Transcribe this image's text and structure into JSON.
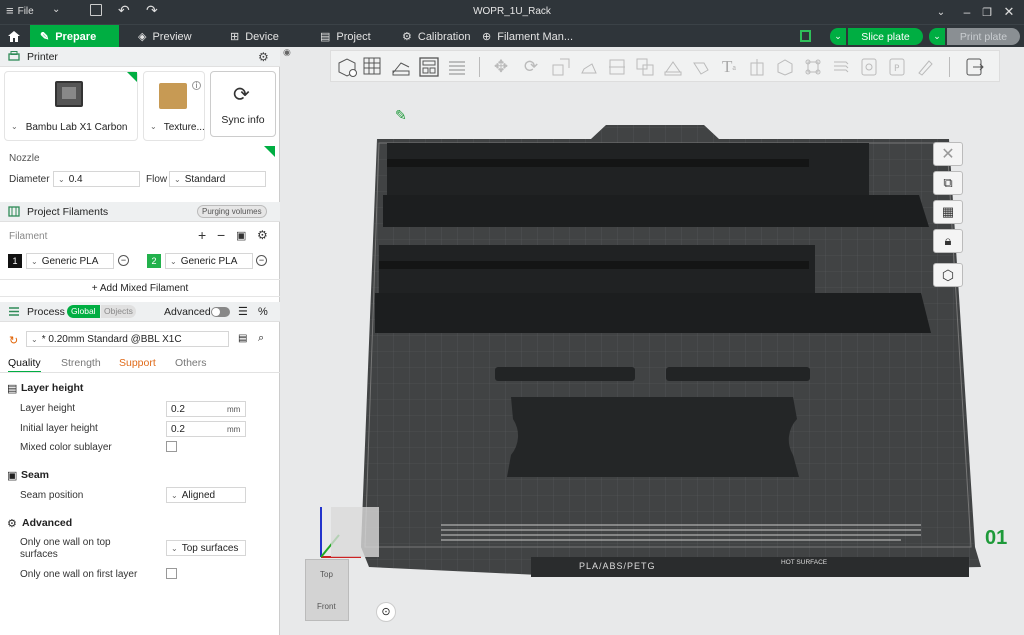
{
  "titlebar": {
    "menu_label": "File",
    "title": "WOPR_1U_Rack"
  },
  "tabs": [
    {
      "label": "Prepare"
    },
    {
      "label": "Preview"
    },
    {
      "label": "Device"
    },
    {
      "label": "Project"
    },
    {
      "label": "Calibration"
    },
    {
      "label": "Filament Man..."
    }
  ],
  "actions": {
    "slice_label": "Slice plate",
    "print_label": "Print plate"
  },
  "printer": {
    "section_title": "Printer",
    "printer_name": "Bambu Lab X1 Carbon",
    "plate_name": "Texture...",
    "sync_label": "Sync info",
    "nozzle_label": "Nozzle",
    "diameter_label": "Diameter",
    "diameter_value": "0.4",
    "flow_label": "Flow",
    "flow_value": "Standard"
  },
  "filaments": {
    "section_title": "Project Filaments",
    "purging_label": "Purging volumes",
    "filament_label": "Filament",
    "items": [
      {
        "index": "1",
        "name": "Generic PLA",
        "color": "#111111"
      },
      {
        "index": "2",
        "name": "Generic PLA",
        "color": "#22b14c"
      }
    ],
    "add_mixed_label": "+ Add Mixed Filament"
  },
  "process": {
    "section_title": "Process",
    "global_label": "Global",
    "objects_label": "Objects",
    "advanced_label": "Advanced",
    "preset": "* 0.20mm Standard @BBL X1C",
    "tabs": [
      "Quality",
      "Strength",
      "Support",
      "Others"
    ],
    "layer_height": {
      "title": "Layer height",
      "rows": [
        {
          "label": "Layer height",
          "value": "0.2",
          "unit": "mm"
        },
        {
          "label": "Initial layer height",
          "value": "0.2",
          "unit": "mm"
        }
      ],
      "mixed_label": "Mixed color sublayer"
    },
    "seam": {
      "title": "Seam",
      "position_label": "Seam position",
      "position_value": "Aligned"
    },
    "advanced": {
      "title": "Advanced",
      "one_wall_top_label": "Only one wall on top surfaces",
      "one_wall_top_value": "Top surfaces",
      "one_wall_first_label": "Only one wall on first layer"
    }
  },
  "viewport": {
    "plate_number": "01",
    "plate_label": "PLA/ABS/PETG",
    "hot_surface_label": "HOT SURFACE",
    "cube_top": "Top",
    "cube_front": "Front"
  }
}
